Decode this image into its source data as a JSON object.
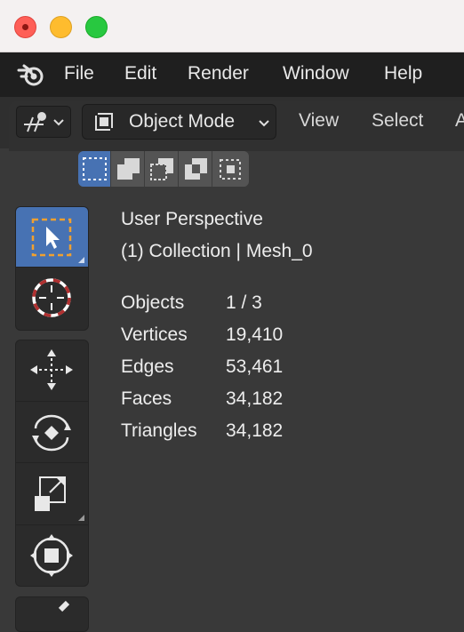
{
  "window": {
    "controls": [
      "close",
      "minimize",
      "zoom"
    ]
  },
  "menubar": {
    "logo_icon": "blender-logo-icon",
    "items": [
      {
        "label": "File"
      },
      {
        "label": "Edit"
      },
      {
        "label": "Render"
      },
      {
        "label": "Window"
      },
      {
        "label": "Help"
      }
    ]
  },
  "header": {
    "editor_type_icon": "3d-viewport-icon",
    "mode": {
      "label": "Object Mode",
      "icon": "object-mode-icon"
    },
    "menus": [
      {
        "label": "View"
      },
      {
        "label": "Select"
      },
      {
        "label": "A"
      }
    ],
    "selection_modes": [
      {
        "name": "new-selection",
        "active": true
      },
      {
        "name": "extend-selection",
        "active": false
      },
      {
        "name": "subtract-selection",
        "active": false
      },
      {
        "name": "invert-selection",
        "active": false
      },
      {
        "name": "intersect-selection",
        "active": false
      }
    ]
  },
  "toolbar": {
    "tools": [
      {
        "name": "select-box",
        "active": true
      },
      {
        "name": "cursor",
        "active": false
      },
      {
        "name": "move",
        "active": false
      },
      {
        "name": "rotate",
        "active": false
      },
      {
        "name": "scale",
        "active": false
      },
      {
        "name": "transform",
        "active": false
      },
      {
        "name": "annotate",
        "active": false
      }
    ]
  },
  "viewport": {
    "perspective": "User Perspective",
    "collection": "(1) Collection | Mesh_0",
    "stats": [
      {
        "label": "Objects",
        "value": "1 / 3"
      },
      {
        "label": "Vertices",
        "value": "19,410"
      },
      {
        "label": "Edges",
        "value": "53,461"
      },
      {
        "label": "Faces",
        "value": "34,182"
      },
      {
        "label": "Triangles",
        "value": "34,182"
      }
    ]
  },
  "colors": {
    "accent": "#4772b3",
    "menubar_bg": "#1f1f1f",
    "viewport_bg": "#393939"
  }
}
